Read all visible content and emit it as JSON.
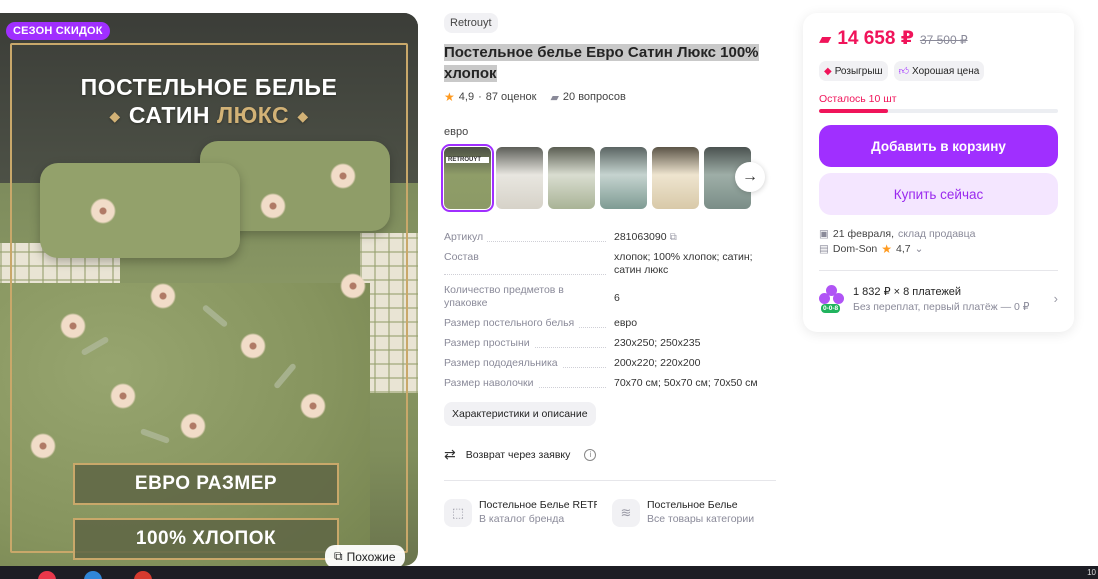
{
  "photo": {
    "sale_badge": "СЕЗОН СКИДОК",
    "headline_line1": "ПОСТЕЛЬНОЕ БЕЛЬЕ",
    "headline_word1": "САТИН",
    "headline_word2": "ЛЮКС",
    "promo1": "ЕВРО РАЗМЕР",
    "promo2": "100% ХЛОПОК",
    "similar_label": "Похожие"
  },
  "product": {
    "brand": "Retrouyt",
    "title": "Постельное белье Евро Сатин Люкс 100% хлопок",
    "rating": "4,9",
    "reviews": "87 оценок",
    "questions": "20 вопросов",
    "variant_label": "евро",
    "thumb_caption": "RETROUYT",
    "thumb_count": 6
  },
  "specs": [
    {
      "key": "Артикул",
      "value": "281063090"
    },
    {
      "key": "Состав",
      "value": "хлопок; 100% хлопок; сатин; сатин люкс"
    },
    {
      "key": "Количество предметов в упаковке",
      "value": "6"
    },
    {
      "key": "Размер постельного белья",
      "value": "евро"
    },
    {
      "key": "Размер простыни",
      "value": "230x250; 250x235"
    },
    {
      "key": "Размер пододеяльника",
      "value": "200x220; 220x200"
    },
    {
      "key": "Размер наволочки",
      "value": "70x70 см; 50x70 см; 70x50 см"
    }
  ],
  "actions": {
    "characteristics": "Характеристики и описание",
    "return": "Возврат через заявку"
  },
  "links": [
    {
      "title": "Постельное Белье RETROUYT",
      "sub": "В каталог бренда",
      "icon": "tag-icon"
    },
    {
      "title": "Постельное Белье",
      "sub": "Все товары категории",
      "icon": "layers-icon"
    }
  ],
  "card": {
    "price": "14 658 ₽",
    "old_price": "37 500 ₽",
    "chip1": "Розыгрыш",
    "chip2": "Хорошая цена",
    "stock": "Осталось 10 шт",
    "stock_fraction": 0.29,
    "add_to_cart": "Добавить в корзину",
    "buy_now": "Купить сейчас",
    "delivery_date": "21 февраля,",
    "delivery_where": "склад продавца",
    "seller": "Dom-Son",
    "seller_rating": "4,7",
    "installment_title": "1 832 ₽ × 8 платежей",
    "installment_sub": "Без переплат, первый платёж — 0 ₽",
    "installment_tag": "0-0-8"
  },
  "taskbar": {
    "clock": "10"
  },
  "colors": {
    "accent": "#a02fff",
    "price": "#f0145a",
    "gold": "#c9a86a"
  }
}
